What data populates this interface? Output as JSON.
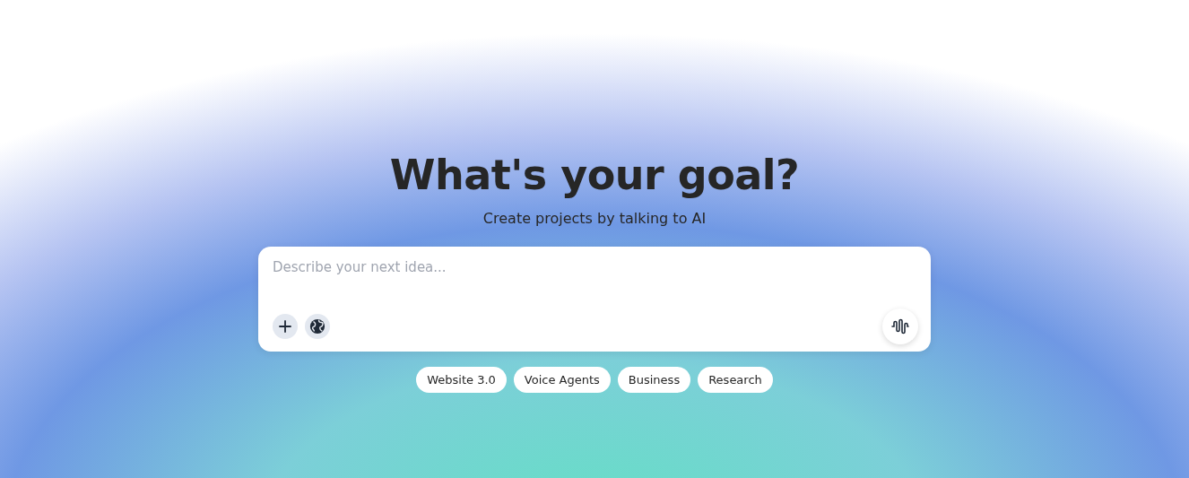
{
  "hero": {
    "title": "What's your goal?",
    "subtitle": "Create projects by talking to AI"
  },
  "prompt": {
    "placeholder": "Describe your next idea..."
  },
  "suggestions": [
    "Website 3.0",
    "Voice Agents",
    "Business",
    "Research"
  ]
}
